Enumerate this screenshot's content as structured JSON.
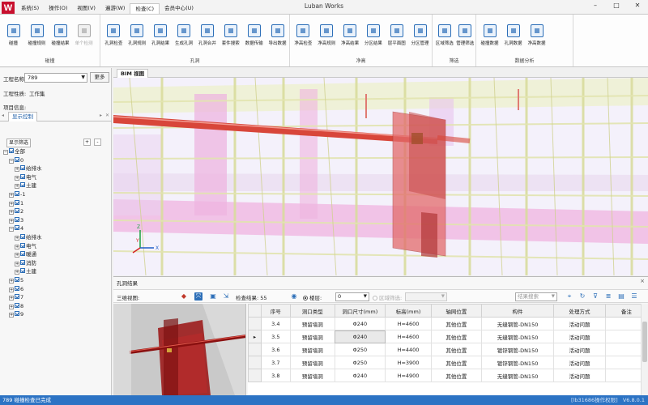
{
  "app": {
    "title": "Luban Works",
    "logo_letter": "W"
  },
  "menu": [
    {
      "label": "系统(S)"
    },
    {
      "label": "操作(O)"
    },
    {
      "label": "视图(V)"
    },
    {
      "label": "遍游(W)"
    },
    {
      "label": "检查(C)",
      "active": true
    },
    {
      "label": "会员中心(U)"
    }
  ],
  "ribbon": {
    "groups": [
      {
        "title": "碰撞",
        "buttons": [
          {
            "label": "碰撞",
            "icon": "collision-icon"
          },
          {
            "label": "碰撞规则",
            "icon": "collision-rules-icon"
          },
          {
            "label": "碰撞结果",
            "icon": "collision-results-icon"
          },
          {
            "label": "单个检测",
            "icon": "single-check-icon",
            "disabled": true
          }
        ]
      },
      {
        "title": "孔洞",
        "buttons": [
          {
            "label": "孔洞检查",
            "icon": "hole-check-icon"
          },
          {
            "label": "孔洞规则",
            "icon": "hole-rules-icon"
          },
          {
            "label": "孔洞结果",
            "icon": "hole-results-icon"
          },
          {
            "label": "生成孔洞",
            "icon": "generate-hole-icon"
          },
          {
            "label": "孔洞合并",
            "icon": "hole-merge-icon"
          },
          {
            "label": "套件搜索",
            "icon": "sleeve-search-icon"
          },
          {
            "label": "数据传输",
            "icon": "data-transfer-icon"
          },
          {
            "label": "导出数据",
            "icon": "export-data-icon"
          }
        ]
      },
      {
        "title": "净高",
        "buttons": [
          {
            "label": "净高检查",
            "icon": "clearance-check-icon"
          },
          {
            "label": "净高规则",
            "icon": "clearance-rules-icon"
          },
          {
            "label": "净高结果",
            "icon": "clearance-results-icon"
          },
          {
            "label": "分区结果",
            "icon": "zone-results-icon"
          },
          {
            "label": "层平面图",
            "icon": "floor-plan-icon"
          },
          {
            "label": "分区管理",
            "icon": "zone-manage-icon"
          }
        ]
      },
      {
        "title": "筛选",
        "buttons": [
          {
            "label": "区域筛选",
            "icon": "area-filter-icon"
          },
          {
            "label": "管理筛选",
            "icon": "manage-filter-icon"
          }
        ]
      },
      {
        "title": "数据分析",
        "buttons": [
          {
            "label": "碰撞数据",
            "icon": "collision-data-icon"
          },
          {
            "label": "孔洞数据",
            "icon": "hole-data-icon"
          },
          {
            "label": "净高数据",
            "icon": "clearance-data-icon"
          }
        ]
      }
    ]
  },
  "left_panel": {
    "project_name_label": "工程名称:",
    "project_name_value": "789",
    "more_button": "更多",
    "project_type_label": "工程性质:",
    "project_type_value": "工作集",
    "project_info_label": "项目信息:",
    "display_tab": "显示控制",
    "filter_button": "显示筛选",
    "plus": "+",
    "minus": "-",
    "tree": [
      {
        "label": "全部",
        "level": 0,
        "exp": "−"
      },
      {
        "label": "0",
        "level": 1,
        "exp": "−"
      },
      {
        "label": "给排水",
        "level": 2,
        "exp": "+"
      },
      {
        "label": "电气",
        "level": 2,
        "exp": "+"
      },
      {
        "label": "土建",
        "level": 2,
        "exp": "+"
      },
      {
        "label": "-1",
        "level": 1,
        "exp": "+"
      },
      {
        "label": "1",
        "level": 1,
        "exp": "+"
      },
      {
        "label": "2",
        "level": 1,
        "exp": "+"
      },
      {
        "label": "3",
        "level": 1,
        "exp": "+"
      },
      {
        "label": "4",
        "level": 1,
        "exp": "−"
      },
      {
        "label": "给排水",
        "level": 2,
        "exp": "+"
      },
      {
        "label": "电气",
        "level": 2,
        "exp": "+"
      },
      {
        "label": "暖通",
        "level": 2,
        "exp": "+"
      },
      {
        "label": "消防",
        "level": 2,
        "exp": "+"
      },
      {
        "label": "土建",
        "level": 2,
        "exp": "+"
      },
      {
        "label": "5",
        "level": 1,
        "exp": "+"
      },
      {
        "label": "6",
        "level": 1,
        "exp": "+"
      },
      {
        "label": "7",
        "level": 1,
        "exp": "+"
      },
      {
        "label": "8",
        "level": 1,
        "exp": "+"
      },
      {
        "label": "9",
        "level": 1,
        "exp": "+"
      }
    ]
  },
  "viewport": {
    "tab": "BIM 视图",
    "axes": {
      "x": "X",
      "y": "Y",
      "z": "Z"
    }
  },
  "results_panel": {
    "title": "孔洞结果",
    "close": "×",
    "view_label": "三维视图:",
    "check_result": "检查结果: 55",
    "floor_label": "楼层:",
    "floor_value": "0",
    "area_filter_label": "区域筛选:",
    "search_placeholder": "结果搜索",
    "columns": [
      "序号",
      "洞口类型",
      "洞口尺寸(mm)",
      "标高(mm)",
      "轴网位置",
      "构件",
      "处理方式",
      "备注"
    ],
    "rows": [
      [
        "3.4",
        "预留墙洞",
        "Φ240",
        "H=4600",
        "其他位置",
        "无缝钢管-DN150",
        "活动问题",
        ""
      ],
      [
        "3.5",
        "预留墙洞",
        "Φ240",
        "H=4600",
        "其他位置",
        "无缝钢管-DN150",
        "活动问题",
        ""
      ],
      [
        "3.6",
        "预留墙洞",
        "Φ250",
        "H=4400",
        "其他位置",
        "镀锌钢管-DN150",
        "活动问题",
        ""
      ],
      [
        "3.7",
        "预留墙洞",
        "Φ250",
        "H=3900",
        "其他位置",
        "镀锌钢管-DN150",
        "活动问题",
        ""
      ],
      [
        "3.8",
        "预留墙洞",
        "Φ240",
        "H=4900",
        "其他位置",
        "无缝钢管-DN150",
        "活动问题",
        ""
      ]
    ],
    "current_row_index": 1,
    "current_row_marker": "▸"
  },
  "status": {
    "left": "789 碰撞检查已完成",
    "middle": "[lb31686操作权限]",
    "right": "V6.8.0.1"
  },
  "colors": {
    "accent": "#2c73c4",
    "pipe": "#d8463a",
    "hole": "#e36b6b"
  }
}
